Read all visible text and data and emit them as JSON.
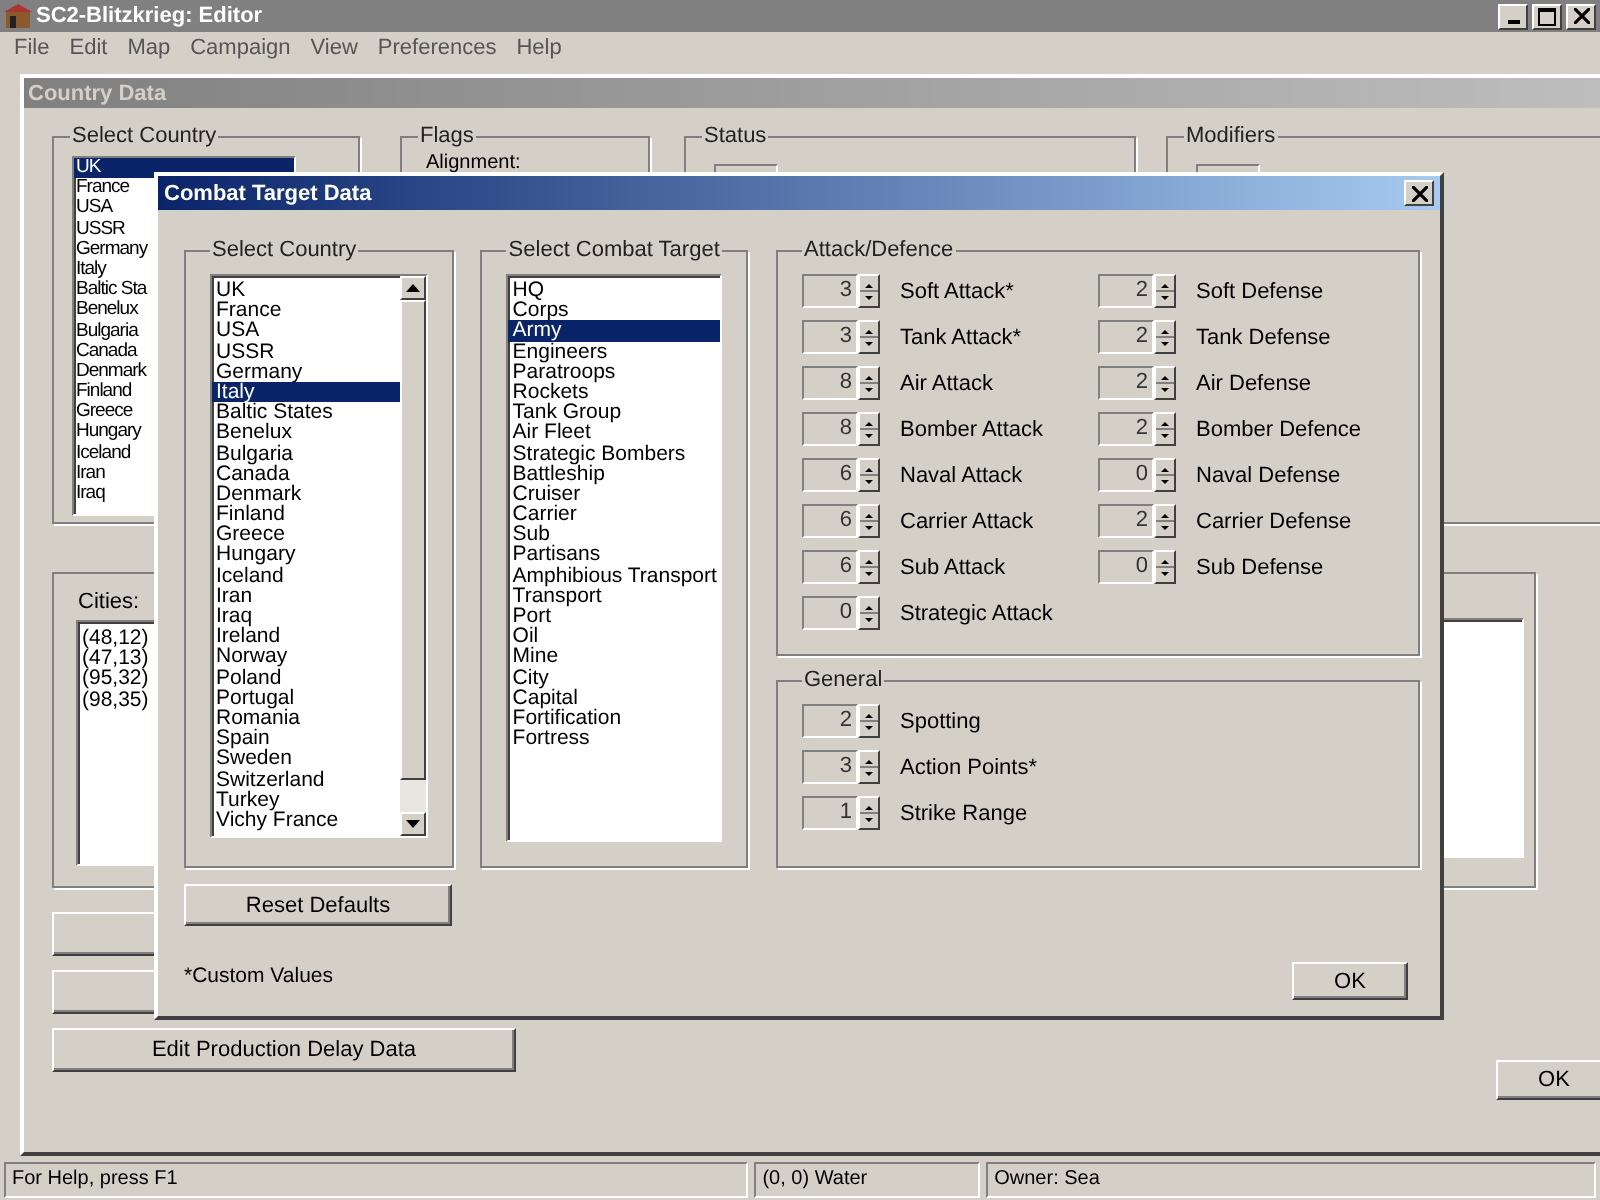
{
  "app": {
    "title": "SC2-Blitzkrieg: Editor",
    "menu": [
      "File",
      "Edit",
      "Map",
      "Campaign",
      "View",
      "Preferences",
      "Help"
    ]
  },
  "country_data": {
    "title": "Country Data",
    "select_country": {
      "label": "Select Country",
      "items": [
        {
          "label": "UK",
          "selected": true
        },
        {
          "label": "France",
          "selected": false
        },
        {
          "label": "USA",
          "selected": false
        },
        {
          "label": "USSR",
          "selected": false
        },
        {
          "label": "Germany",
          "selected": false
        },
        {
          "label": "Italy",
          "selected": false
        },
        {
          "label": "Baltic Sta",
          "selected": false
        },
        {
          "label": "Benelux",
          "selected": false
        },
        {
          "label": "Bulgaria",
          "selected": false
        },
        {
          "label": "Canada",
          "selected": false
        },
        {
          "label": "Denmark",
          "selected": false
        },
        {
          "label": "Finland",
          "selected": false
        },
        {
          "label": "Greece",
          "selected": false
        },
        {
          "label": "Hungary",
          "selected": false
        },
        {
          "label": "Iceland",
          "selected": false
        },
        {
          "label": "Iran",
          "selected": false
        },
        {
          "label": "Iraq",
          "selected": false
        }
      ]
    },
    "flags": {
      "label": "Flags",
      "alignment_label": "Alignment:"
    },
    "status": {
      "label": "Status"
    },
    "modifiers": {
      "label": "Modifiers"
    },
    "cities": {
      "label": "Cities:",
      "items": [
        "(48,12)",
        "(47,13)",
        "(95,32)",
        "(98,35)"
      ]
    },
    "edit_button": "Edit Production Delay Data",
    "ok": "OK"
  },
  "combat_target": {
    "title": "Combat Target Data",
    "select_country": {
      "label": "Select Country",
      "items": [
        {
          "label": "UK",
          "selected": false
        },
        {
          "label": "France",
          "selected": false
        },
        {
          "label": "USA",
          "selected": false
        },
        {
          "label": "USSR",
          "selected": false
        },
        {
          "label": "Germany",
          "selected": false
        },
        {
          "label": "Italy",
          "selected": true
        },
        {
          "label": "Baltic States",
          "selected": false
        },
        {
          "label": "Benelux",
          "selected": false
        },
        {
          "label": "Bulgaria",
          "selected": false
        },
        {
          "label": "Canada",
          "selected": false
        },
        {
          "label": "Denmark",
          "selected": false
        },
        {
          "label": "Finland",
          "selected": false
        },
        {
          "label": "Greece",
          "selected": false
        },
        {
          "label": "Hungary",
          "selected": false
        },
        {
          "label": "Iceland",
          "selected": false
        },
        {
          "label": "Iran",
          "selected": false
        },
        {
          "label": "Iraq",
          "selected": false
        },
        {
          "label": "Ireland",
          "selected": false
        },
        {
          "label": "Norway",
          "selected": false
        },
        {
          "label": "Poland",
          "selected": false
        },
        {
          "label": "Portugal",
          "selected": false
        },
        {
          "label": "Romania",
          "selected": false
        },
        {
          "label": "Spain",
          "selected": false
        },
        {
          "label": "Sweden",
          "selected": false
        },
        {
          "label": "Switzerland",
          "selected": false
        },
        {
          "label": "Turkey",
          "selected": false
        },
        {
          "label": "Vichy France",
          "selected": false
        }
      ]
    },
    "select_target": {
      "label": "Select Combat Target",
      "items": [
        {
          "label": "HQ",
          "selected": false
        },
        {
          "label": "Corps",
          "selected": false
        },
        {
          "label": "Army",
          "selected": true
        },
        {
          "label": "Engineers",
          "selected": false
        },
        {
          "label": "Paratroops",
          "selected": false
        },
        {
          "label": "Rockets",
          "selected": false
        },
        {
          "label": "Tank Group",
          "selected": false
        },
        {
          "label": "Air Fleet",
          "selected": false
        },
        {
          "label": "Strategic Bombers",
          "selected": false
        },
        {
          "label": "Battleship",
          "selected": false
        },
        {
          "label": "Cruiser",
          "selected": false
        },
        {
          "label": "Carrier",
          "selected": false
        },
        {
          "label": "Sub",
          "selected": false
        },
        {
          "label": "Partisans",
          "selected": false
        },
        {
          "label": "Amphibious Transport",
          "selected": false
        },
        {
          "label": "Transport",
          "selected": false
        },
        {
          "label": "Port",
          "selected": false
        },
        {
          "label": "Oil",
          "selected": false
        },
        {
          "label": "Mine",
          "selected": false
        },
        {
          "label": "City",
          "selected": false
        },
        {
          "label": "Capital",
          "selected": false
        },
        {
          "label": "Fortification",
          "selected": false
        },
        {
          "label": "Fortress",
          "selected": false
        }
      ]
    },
    "attack_defence": {
      "label": "Attack/Defence",
      "attack": [
        {
          "value": "3",
          "label": "Soft Attack*"
        },
        {
          "value": "3",
          "label": "Tank Attack*"
        },
        {
          "value": "8",
          "label": "Air Attack"
        },
        {
          "value": "8",
          "label": "Bomber Attack"
        },
        {
          "value": "6",
          "label": "Naval Attack"
        },
        {
          "value": "6",
          "label": "Carrier Attack"
        },
        {
          "value": "6",
          "label": "Sub Attack"
        },
        {
          "value": "0",
          "label": "Strategic Attack"
        }
      ],
      "defence": [
        {
          "value": "2",
          "label": "Soft Defense"
        },
        {
          "value": "2",
          "label": "Tank Defense"
        },
        {
          "value": "2",
          "label": "Air Defense"
        },
        {
          "value": "2",
          "label": "Bomber Defence"
        },
        {
          "value": "0",
          "label": "Naval Defense"
        },
        {
          "value": "2",
          "label": "Carrier Defense"
        },
        {
          "value": "0",
          "label": "Sub Defense"
        }
      ]
    },
    "general": {
      "label": "General",
      "stats": [
        {
          "value": "2",
          "label": "Spotting"
        },
        {
          "value": "3",
          "label": "Action Points*"
        },
        {
          "value": "1",
          "label": "Strike Range"
        }
      ]
    },
    "reset_button": "Reset Defaults",
    "footnote": "*Custom Values",
    "ok": "OK"
  },
  "status_bar": [
    "For Help, press F1",
    "(0, 0) Water",
    "Owner:  Sea"
  ]
}
